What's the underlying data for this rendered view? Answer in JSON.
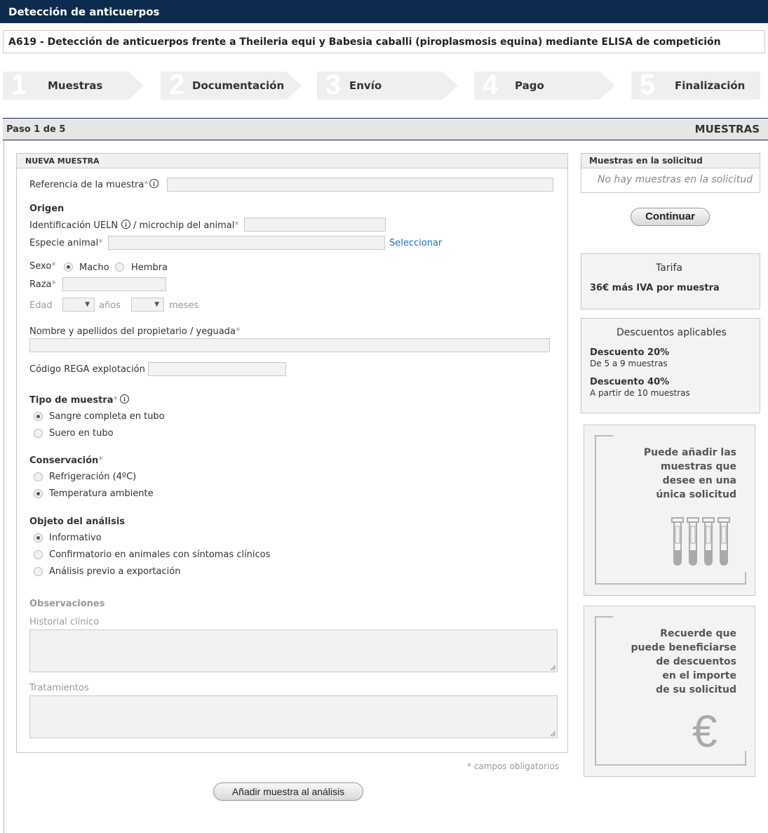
{
  "header": {
    "title": "Detección de anticuerpos",
    "analysis_title": "A619 - Detección de anticuerpos frente a Theileria equi y Babesia caballi (piroplasmosis equina) mediante ELISA de competición"
  },
  "steps": [
    {
      "num": "1",
      "label": "Muestras"
    },
    {
      "num": "2",
      "label": "Documentación"
    },
    {
      "num": "3",
      "label": "Envío"
    },
    {
      "num": "4",
      "label": "Pago"
    },
    {
      "num": "5",
      "label": "Finalización"
    }
  ],
  "step_bar": {
    "progress": "Paso 1 de 5",
    "section": "MUESTRAS"
  },
  "form": {
    "panel_title": "NUEVA MUESTRA",
    "sample_ref_label": "Referencia de la muestra",
    "required_mark": "*",
    "info_glyph": "i",
    "origin_heading": "Origen",
    "ueln_label_a": "Identificación UELN",
    "ueln_label_b": "/ microchip del animal",
    "species_label": "Especie animal",
    "select_link": "Seleccionar",
    "sex_label": "Sexo",
    "sex_options": [
      "Macho",
      "Hembra"
    ],
    "sex_selected": "Macho",
    "breed_label": "Raza",
    "age_label": "Edad",
    "years_label": "años",
    "months_label": "meses",
    "dropdown_arrow": "▼",
    "owner_label": "Nombre y apellidos del propietario / yeguada",
    "rega_label": "Código REGA explotación",
    "sample_type_heading": "Tipo de muestra",
    "sample_type_options": [
      "Sangre completa en tubo",
      "Suero en tubo"
    ],
    "sample_type_selected": "Sangre completa en tubo",
    "conservation_heading": "Conservación",
    "conservation_options": [
      "Refrigeración (4ºC)",
      "Temperatura ambiente"
    ],
    "conservation_selected": "Temperatura ambiente",
    "purpose_heading": "Objeto del análisis",
    "purpose_options": [
      "Informativo",
      "Confirmatorio en animales con síntomas clínicos",
      "Análisis previo a exportación"
    ],
    "purpose_selected": "Informativo",
    "observations_heading": "Observaciones",
    "clinical_history_label": "Historial clínico",
    "treatments_label": "Tratamientos",
    "required_note": "* campos obligatorios",
    "add_button": "Añadir muestra al análisis"
  },
  "sidebar": {
    "samples_title": "Muestras en la solicitud",
    "samples_empty": "No hay muestras en la solicitud",
    "continue_button": "Continuar",
    "rate_title": "Tarifa",
    "rate_value": "36€ más IVA por muestra",
    "discounts_title": "Descuentos aplicables",
    "discount1_title": "Descuento 20%",
    "discount1_desc": "De 5 a 9 muestras",
    "discount2_title": "Descuento 40%",
    "discount2_desc": "A partir de 10 muestras",
    "promo1_lines": [
      "Puede añadir las",
      "muestras que",
      "desee en una",
      "única solicitud"
    ],
    "promo2_lines": [
      "Recuerde que",
      "puede beneficiarse",
      "de descuentos",
      "en el importe",
      "de su solicitud"
    ],
    "euro_glyph": "€"
  },
  "colors": {
    "header_bg": "#0d2a4f",
    "step_bg": "#efefef",
    "link": "#1f6fb2"
  }
}
